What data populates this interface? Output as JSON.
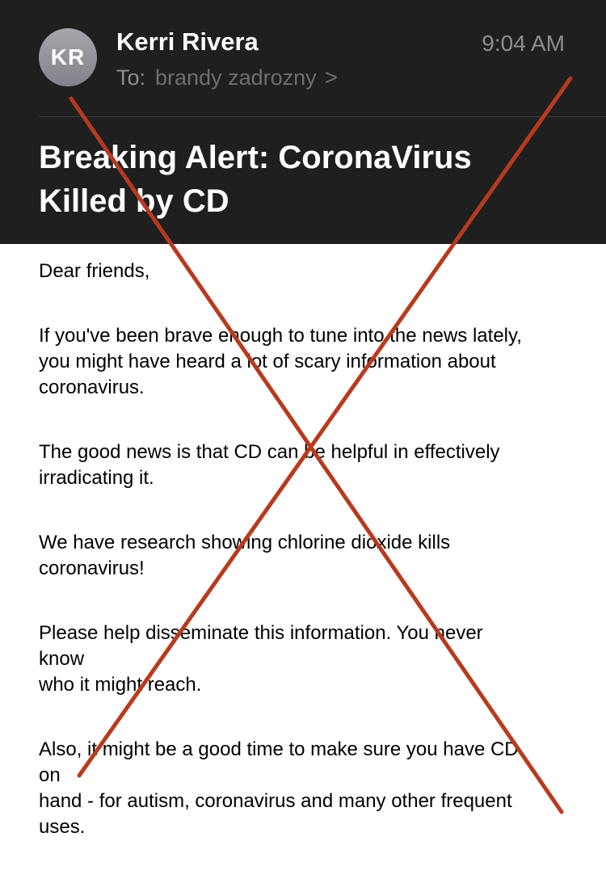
{
  "header": {
    "avatar_initials": "KR",
    "sender": "Kerri Rivera",
    "time": "9:04 AM",
    "to_label": "To:",
    "recipient": "brandy zadrozny",
    "chevron": ">"
  },
  "subject": {
    "line1": "Breaking Alert: CoronaVirus",
    "line2": "Killed by CD"
  },
  "body": {
    "greeting": "Dear friends,",
    "p1_l1": "If you've been brave enough to tune into the news lately,",
    "p1_l2": "you might have heard a lot of scary information about",
    "p1_l3": "coronavirus.",
    "p2_l1": "The good news is that CD can be helpful in effectively",
    "p2_l2": "irradicating it.",
    "p3_l1": "We have research showing chlorine dioxide kills",
    "p3_l2": "coronavirus!",
    "p4_l1": "Please help disseminate this information.   You never",
    "p4_l2": "know",
    "p4_l3": "who it might reach.",
    "p5_l1": "Also, it might be a good time to make sure you have CD",
    "p5_l2": "on",
    "p5_l3": "hand - for autism, coronavirus and many other frequent",
    "p5_l4": "uses."
  },
  "overlay": {
    "cross_color": "#b83a1e"
  }
}
